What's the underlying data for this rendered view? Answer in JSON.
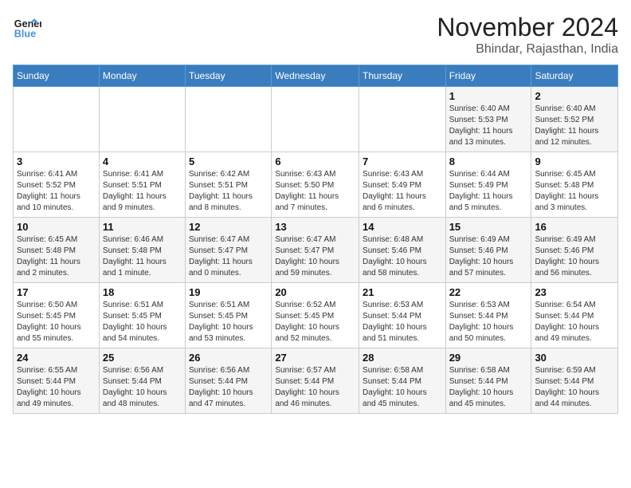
{
  "header": {
    "logo_line1": "General",
    "logo_line2": "Blue",
    "month": "November 2024",
    "location": "Bhindar, Rajasthan, India"
  },
  "weekdays": [
    "Sunday",
    "Monday",
    "Tuesday",
    "Wednesday",
    "Thursday",
    "Friday",
    "Saturday"
  ],
  "weeks": [
    [
      {
        "day": "",
        "info": ""
      },
      {
        "day": "",
        "info": ""
      },
      {
        "day": "",
        "info": ""
      },
      {
        "day": "",
        "info": ""
      },
      {
        "day": "",
        "info": ""
      },
      {
        "day": "1",
        "info": "Sunrise: 6:40 AM\nSunset: 5:53 PM\nDaylight: 11 hours\nand 13 minutes."
      },
      {
        "day": "2",
        "info": "Sunrise: 6:40 AM\nSunset: 5:52 PM\nDaylight: 11 hours\nand 12 minutes."
      }
    ],
    [
      {
        "day": "3",
        "info": "Sunrise: 6:41 AM\nSunset: 5:52 PM\nDaylight: 11 hours\nand 10 minutes."
      },
      {
        "day": "4",
        "info": "Sunrise: 6:41 AM\nSunset: 5:51 PM\nDaylight: 11 hours\nand 9 minutes."
      },
      {
        "day": "5",
        "info": "Sunrise: 6:42 AM\nSunset: 5:51 PM\nDaylight: 11 hours\nand 8 minutes."
      },
      {
        "day": "6",
        "info": "Sunrise: 6:43 AM\nSunset: 5:50 PM\nDaylight: 11 hours\nand 7 minutes."
      },
      {
        "day": "7",
        "info": "Sunrise: 6:43 AM\nSunset: 5:49 PM\nDaylight: 11 hours\nand 6 minutes."
      },
      {
        "day": "8",
        "info": "Sunrise: 6:44 AM\nSunset: 5:49 PM\nDaylight: 11 hours\nand 5 minutes."
      },
      {
        "day": "9",
        "info": "Sunrise: 6:45 AM\nSunset: 5:48 PM\nDaylight: 11 hours\nand 3 minutes."
      }
    ],
    [
      {
        "day": "10",
        "info": "Sunrise: 6:45 AM\nSunset: 5:48 PM\nDaylight: 11 hours\nand 2 minutes."
      },
      {
        "day": "11",
        "info": "Sunrise: 6:46 AM\nSunset: 5:48 PM\nDaylight: 11 hours\nand 1 minute."
      },
      {
        "day": "12",
        "info": "Sunrise: 6:47 AM\nSunset: 5:47 PM\nDaylight: 11 hours\nand 0 minutes."
      },
      {
        "day": "13",
        "info": "Sunrise: 6:47 AM\nSunset: 5:47 PM\nDaylight: 10 hours\nand 59 minutes."
      },
      {
        "day": "14",
        "info": "Sunrise: 6:48 AM\nSunset: 5:46 PM\nDaylight: 10 hours\nand 58 minutes."
      },
      {
        "day": "15",
        "info": "Sunrise: 6:49 AM\nSunset: 5:46 PM\nDaylight: 10 hours\nand 57 minutes."
      },
      {
        "day": "16",
        "info": "Sunrise: 6:49 AM\nSunset: 5:46 PM\nDaylight: 10 hours\nand 56 minutes."
      }
    ],
    [
      {
        "day": "17",
        "info": "Sunrise: 6:50 AM\nSunset: 5:45 PM\nDaylight: 10 hours\nand 55 minutes."
      },
      {
        "day": "18",
        "info": "Sunrise: 6:51 AM\nSunset: 5:45 PM\nDaylight: 10 hours\nand 54 minutes."
      },
      {
        "day": "19",
        "info": "Sunrise: 6:51 AM\nSunset: 5:45 PM\nDaylight: 10 hours\nand 53 minutes."
      },
      {
        "day": "20",
        "info": "Sunrise: 6:52 AM\nSunset: 5:45 PM\nDaylight: 10 hours\nand 52 minutes."
      },
      {
        "day": "21",
        "info": "Sunrise: 6:53 AM\nSunset: 5:44 PM\nDaylight: 10 hours\nand 51 minutes."
      },
      {
        "day": "22",
        "info": "Sunrise: 6:53 AM\nSunset: 5:44 PM\nDaylight: 10 hours\nand 50 minutes."
      },
      {
        "day": "23",
        "info": "Sunrise: 6:54 AM\nSunset: 5:44 PM\nDaylight: 10 hours\nand 49 minutes."
      }
    ],
    [
      {
        "day": "24",
        "info": "Sunrise: 6:55 AM\nSunset: 5:44 PM\nDaylight: 10 hours\nand 49 minutes."
      },
      {
        "day": "25",
        "info": "Sunrise: 6:56 AM\nSunset: 5:44 PM\nDaylight: 10 hours\nand 48 minutes."
      },
      {
        "day": "26",
        "info": "Sunrise: 6:56 AM\nSunset: 5:44 PM\nDaylight: 10 hours\nand 47 minutes."
      },
      {
        "day": "27",
        "info": "Sunrise: 6:57 AM\nSunset: 5:44 PM\nDaylight: 10 hours\nand 46 minutes."
      },
      {
        "day": "28",
        "info": "Sunrise: 6:58 AM\nSunset: 5:44 PM\nDaylight: 10 hours\nand 45 minutes."
      },
      {
        "day": "29",
        "info": "Sunrise: 6:58 AM\nSunset: 5:44 PM\nDaylight: 10 hours\nand 45 minutes."
      },
      {
        "day": "30",
        "info": "Sunrise: 6:59 AM\nSunset: 5:44 PM\nDaylight: 10 hours\nand 44 minutes."
      }
    ]
  ]
}
